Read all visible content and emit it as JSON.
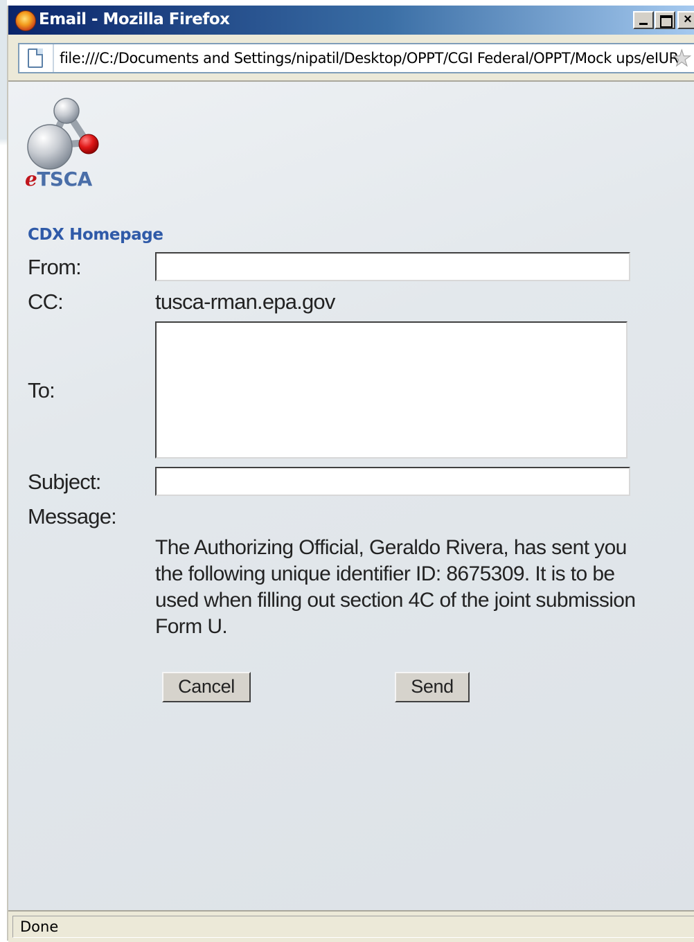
{
  "window": {
    "title": "Email - Mozilla Firefox",
    "address": "file:///C:/Documents and Settings/nipatil/Desktop/OPPT/CGI Federal/OPPT/Mock ups/eIUR"
  },
  "logo": {
    "prefix": "e",
    "name": "TSCA"
  },
  "nav": {
    "home_link": "CDX Homepage"
  },
  "form": {
    "from_label": "From:",
    "from_value": "",
    "cc_label": "CC:",
    "cc_value": "tusca-rman.epa.gov",
    "to_label": "To:",
    "to_value": "",
    "subject_label": "Subject:",
    "subject_value": "",
    "message_label": "Message:",
    "message_text": "The Authorizing Official, Geraldo Rivera, has sent you the following unique identifier ID: 8675309. It is to be used when filling out section 4C of the joint submission Form U."
  },
  "buttons": {
    "cancel": "Cancel",
    "send": "Send"
  },
  "status": {
    "text": "Done"
  },
  "colors": {
    "title_bar_start": "#0a246a",
    "link": "#2f5aa8",
    "logo_blue": "#4a6ea8",
    "logo_red": "#c0151c"
  }
}
